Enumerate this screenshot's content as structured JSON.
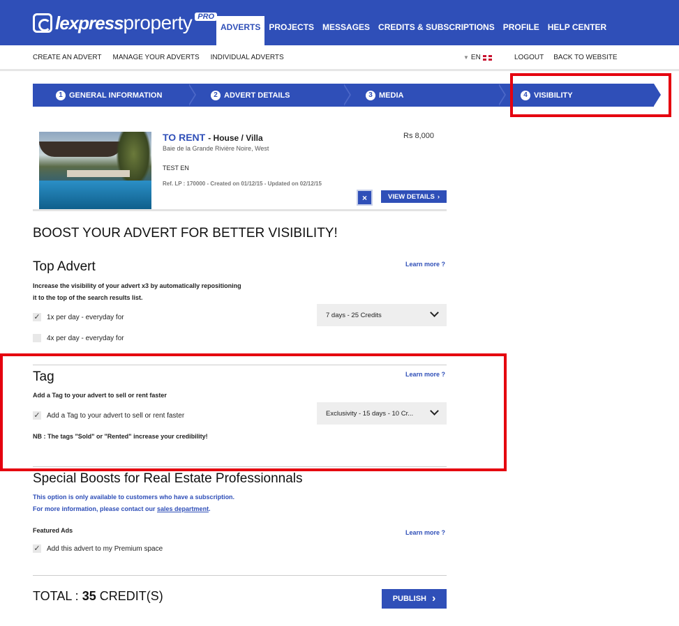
{
  "brand": {
    "name_bold": "lexpress",
    "name_light": "property",
    "badge": "PRO"
  },
  "main_nav": [
    {
      "label": "ADVERTS",
      "active": true
    },
    {
      "label": "PROJECTS",
      "active": false
    },
    {
      "label": "MESSAGES",
      "active": false
    },
    {
      "label": "CREDITS & SUBSCRIPTIONS",
      "active": false
    },
    {
      "label": "PROFILE",
      "active": false
    },
    {
      "label": "HELP CENTER",
      "active": false
    }
  ],
  "sub_nav": [
    "CREATE AN ADVERT",
    "MANAGE YOUR ADVERTS",
    "INDIVIDUAL ADVERTS"
  ],
  "language": "EN",
  "right_links": [
    "LOGOUT",
    "BACK TO WEBSITE"
  ],
  "steps": [
    {
      "num": "1",
      "label": "GENERAL INFORMATION"
    },
    {
      "num": "2",
      "label": "ADVERT DETAILS"
    },
    {
      "num": "3",
      "label": "MEDIA"
    },
    {
      "num": "4",
      "label": "VISIBILITY"
    }
  ],
  "listing": {
    "kind": "TO RENT",
    "type": "- House / Villa",
    "location": "Baie de la Grande Rivière Noire, West",
    "price": "Rs 8,000",
    "description": "TEST EN",
    "ref": "Ref. LP : 170000 - Created on 01/12/15 - Updated on 02/12/15",
    "close_icon": "×",
    "view_details": "VIEW DETAILS"
  },
  "boost_title": "BOOST YOUR ADVERT FOR BETTER VISIBILITY!",
  "learn_more": "Learn more ?",
  "top_advert": {
    "title": "Top Advert",
    "desc_line1": "Increase the visibility of your advert x3 by automatically repositioning",
    "desc_line2": "it to the top of the search results list.",
    "option1": "1x per day - everyday for",
    "option2": "4x per day - everyday for",
    "select_value": "7 days - 25 Credits"
  },
  "tag": {
    "title": "Tag",
    "desc": "Add a Tag to your advert to sell or rent faster",
    "option": "Add a Tag to your advert to sell or rent faster",
    "select_value": "Exclusivity - 15 days - 10 Cr...",
    "note": "NB : The tags \"Sold\" or \"Rented\" increase your credibility!"
  },
  "special": {
    "title": "Special Boosts for Real Estate Professionnals",
    "note_line1": "This option is only available to customers who have a subscription.",
    "note_line2_prefix": "For more information, please contact our ",
    "note_link": "sales department",
    "note_line2_suffix": ".",
    "featured_label": "Featured Ads",
    "option": "Add this advert to my Premium space"
  },
  "total": {
    "prefix": "TOTAL : ",
    "amount": "35",
    "suffix": " CREDIT(S)"
  },
  "publish": "PUBLISH",
  "colors": {
    "brand_blue": "#2f4fb8",
    "highlight_red": "#e5000f"
  }
}
